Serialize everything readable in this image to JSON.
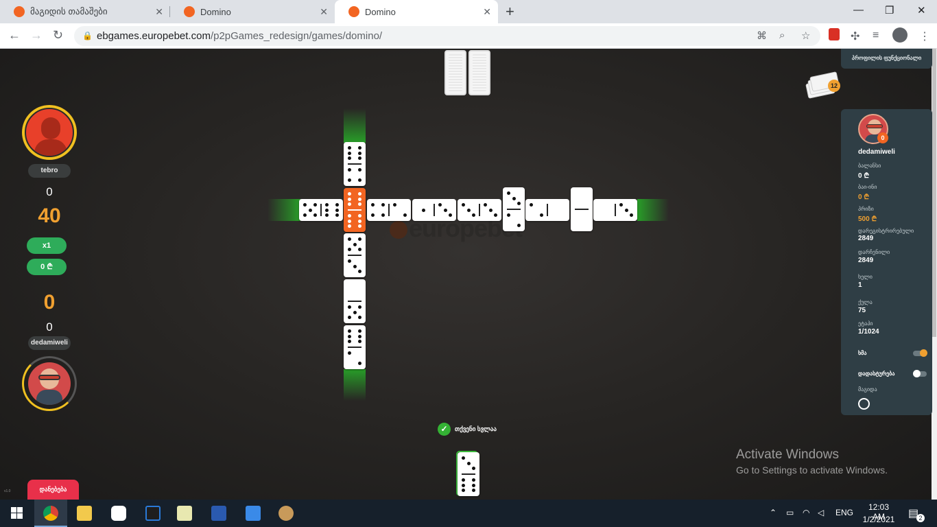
{
  "browser": {
    "tabs": [
      {
        "title": "მაგიდის თამაშები"
      },
      {
        "title": "Domino"
      },
      {
        "title": "Domino"
      }
    ],
    "url_host": "ebgames.europebet.com",
    "url_path": "/p2pGames_redesign/games/domino/"
  },
  "game": {
    "watermark": "europebet",
    "opponent": {
      "name": "tebro",
      "score_top": "0",
      "points": "40",
      "multiplier": "x1",
      "bet": "0 ₾"
    },
    "player": {
      "name": "dedamiweli",
      "points": "0",
      "score_bottom": "0"
    },
    "leave_button": "დანებება",
    "boneyard_count": "12",
    "turn_message": "თქვენი სვლაა",
    "version": "v1.0"
  },
  "panel": {
    "tournament_button": "პროფილის ფუნქციონალი",
    "avatar_badge": "0",
    "username": "dedamiweli",
    "stats": [
      {
        "label": "ბალანსი",
        "value": "0 ₾",
        "accent": false
      },
      {
        "label": "ბაი-ინი",
        "value": "0 ₾",
        "accent": true
      },
      {
        "label": "პრიზი",
        "value": "500 ₾",
        "accent": true
      },
      {
        "label": "დარეგისტრირებული",
        "value": "2849",
        "accent": false
      },
      {
        "label": "დარჩენილი",
        "value": "2849",
        "accent": false
      },
      {
        "label": "ხელი",
        "value": "1",
        "accent": false
      },
      {
        "label": "ქულა",
        "value": "75",
        "accent": false
      },
      {
        "label": "ეტაპი",
        "value": "1/1024",
        "accent": false
      }
    ],
    "sound_label": "ხმა",
    "sound_on": true,
    "confirm_label": "დადასტურება",
    "confirm_on": false,
    "table_label": "მაგიდა",
    "table_colors": [
      "#1e1e1e",
      "#5a2020",
      "#6b3a1a"
    ]
  },
  "windows": {
    "activate_title": "Activate Windows",
    "activate_sub": "Go to Settings to activate Windows.",
    "lang": "ENG",
    "time": "12:03 AM",
    "date": "1/2/2021",
    "notifications": "2"
  },
  "colors": {
    "accent_orange": "#f26522",
    "panel_bg": "#2f3e45",
    "green": "#2eac5a",
    "leave_red": "#e8304a"
  }
}
